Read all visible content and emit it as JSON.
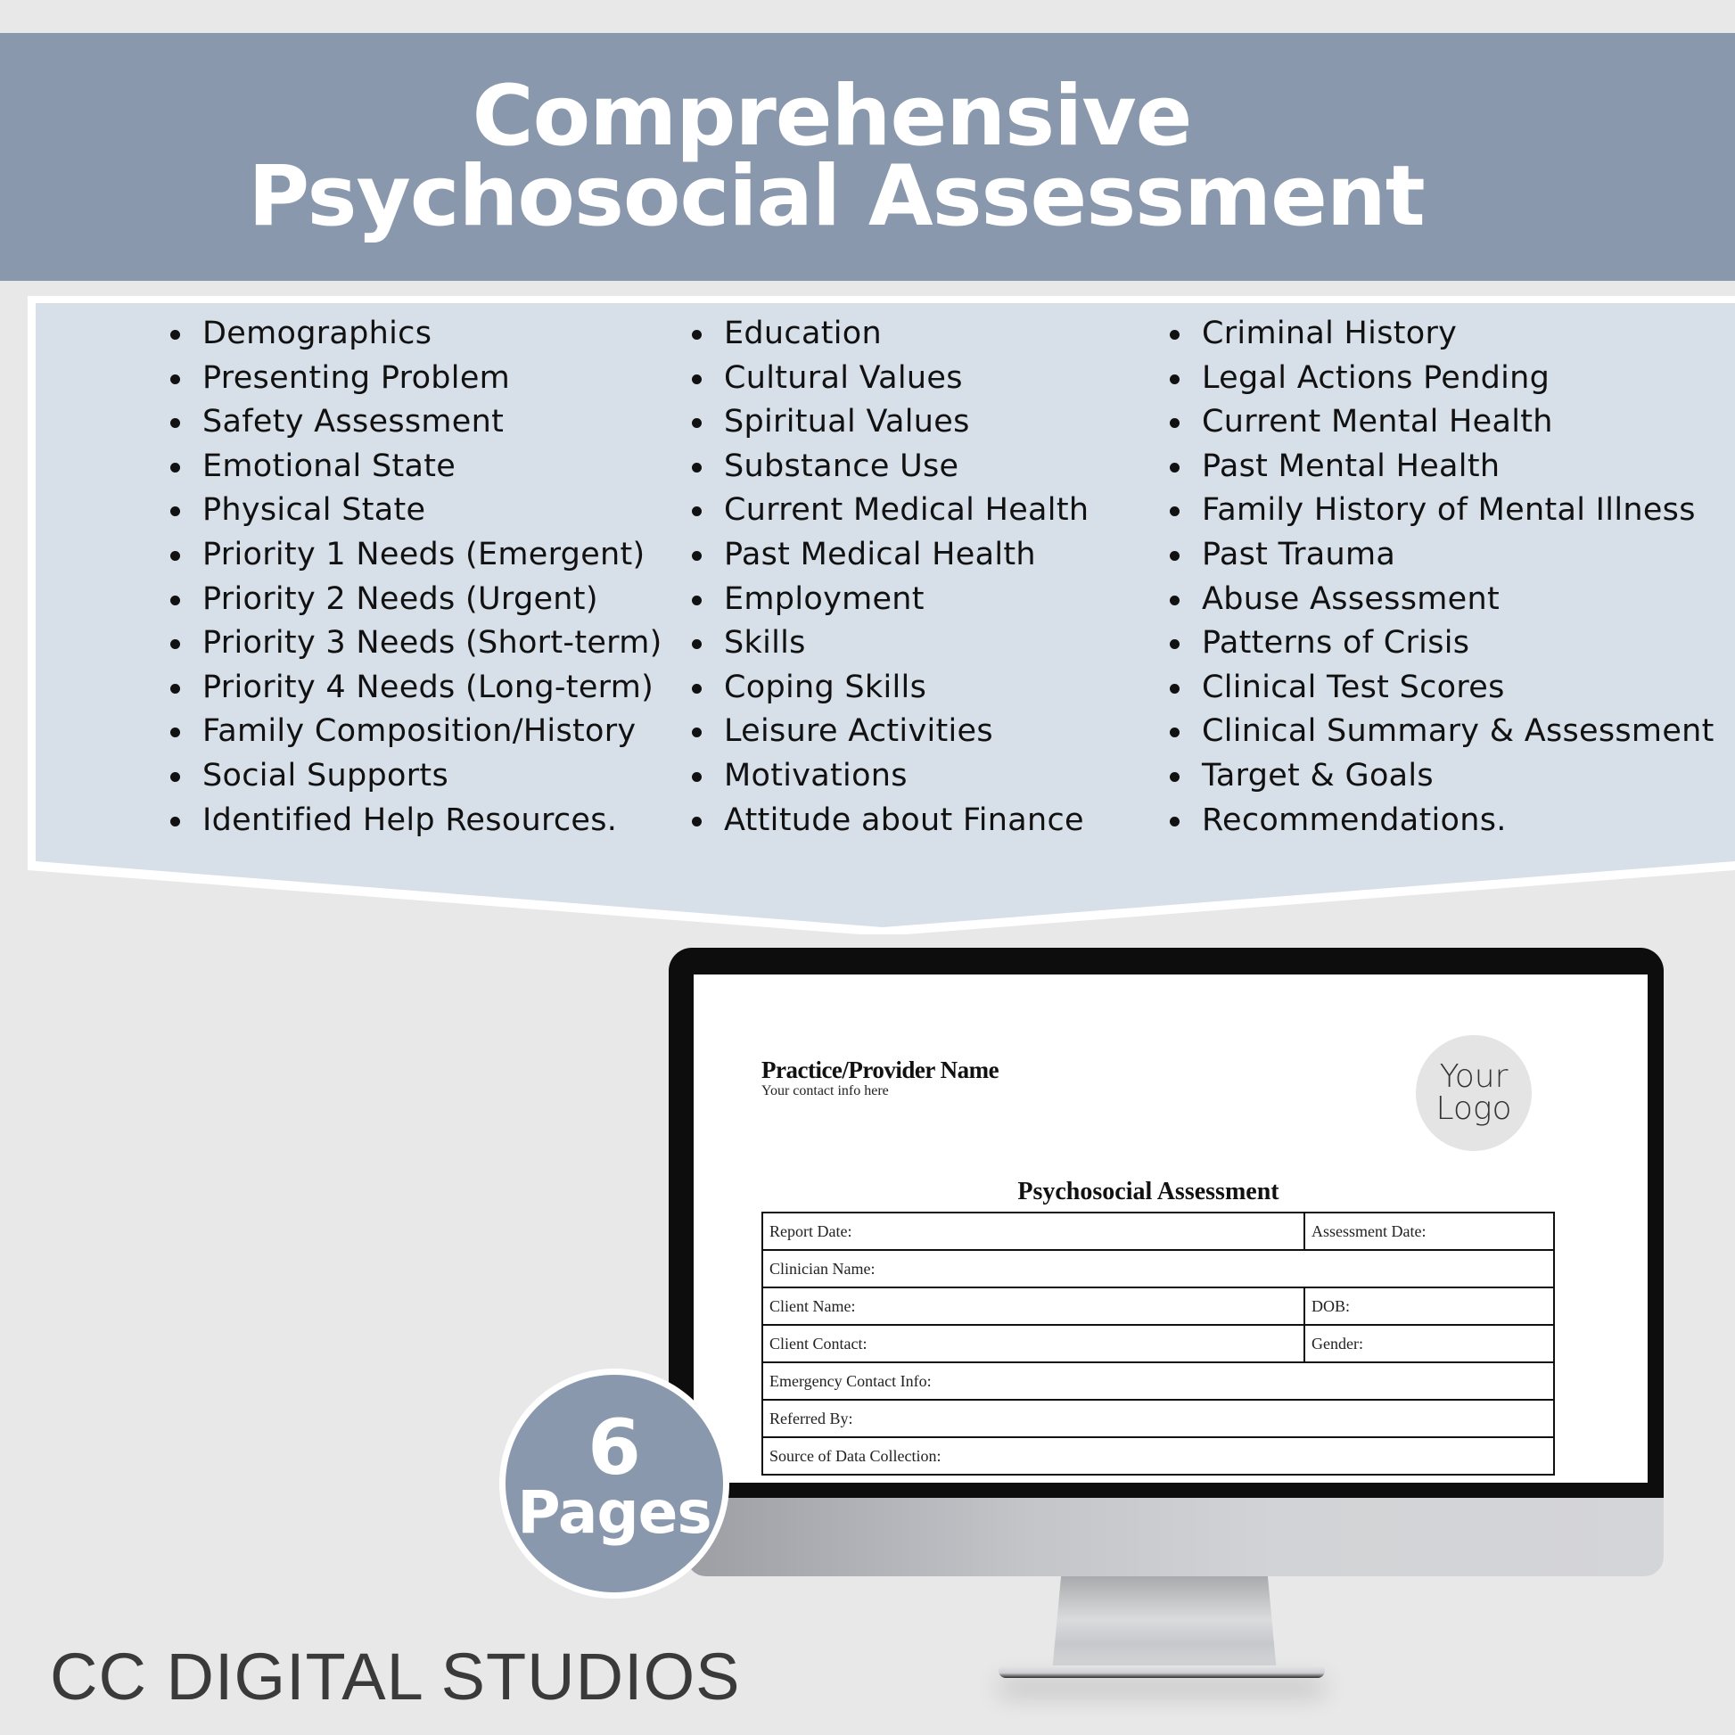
{
  "banner": {
    "title_line1": "Comprehensive",
    "title_line2": "Psychosocial Assessment",
    "color": "#8998ad"
  },
  "features": {
    "columns": [
      [
        "Demographics",
        "Presenting Problem",
        "Safety Assessment",
        "Emotional State",
        "Physical State",
        "Priority 1 Needs (Emergent)",
        "Priority 2 Needs (Urgent)",
        "Priority 3 Needs (Short-term)",
        "Priority 4 Needs (Long-term)",
        "Family Composition/History",
        "Social Supports",
        "Identified Help Resources."
      ],
      [
        "Education",
        "Cultural Values",
        "Spiritual Values",
        "Substance Use",
        "Current Medical Health",
        "Past Medical Health",
        "Employment",
        "Skills",
        "Coping Skills",
        "Leisure Activities",
        "Motivations",
        "Attitude about Finance"
      ],
      [
        "Criminal History",
        "Legal Actions Pending",
        "Current Mental Health",
        "Past Mental Health",
        "Family History of Mental Illness",
        "Past Trauma",
        "Abuse Assessment",
        "Patterns of Crisis",
        "Clinical Test Scores",
        "Clinical Summary & Assessment",
        "Target & Goals",
        "Recommendations."
      ]
    ],
    "panel_color": "#d7dfe8"
  },
  "document": {
    "provider_name": "Practice/Provider Name",
    "contact": "Your contact info here",
    "logo_line1": "Your",
    "logo_line2": "Logo",
    "title": "Psychosocial Assessment",
    "fields": {
      "report_date": "Report Date:",
      "assessment_date": "Assessment Date:",
      "clinician_name": "Clinician Name:",
      "client_name": "Client Name:",
      "dob": "DOB:",
      "client_contact": "Client Contact:",
      "gender": "Gender:",
      "emergency_contact": "Emergency Contact Info:",
      "referred_by": "Referred By:",
      "source_of_data": "Source of Data Collection:"
    }
  },
  "badge": {
    "number": "6",
    "label": "Pages"
  },
  "brand": "CC DIGITAL STUDIOS"
}
